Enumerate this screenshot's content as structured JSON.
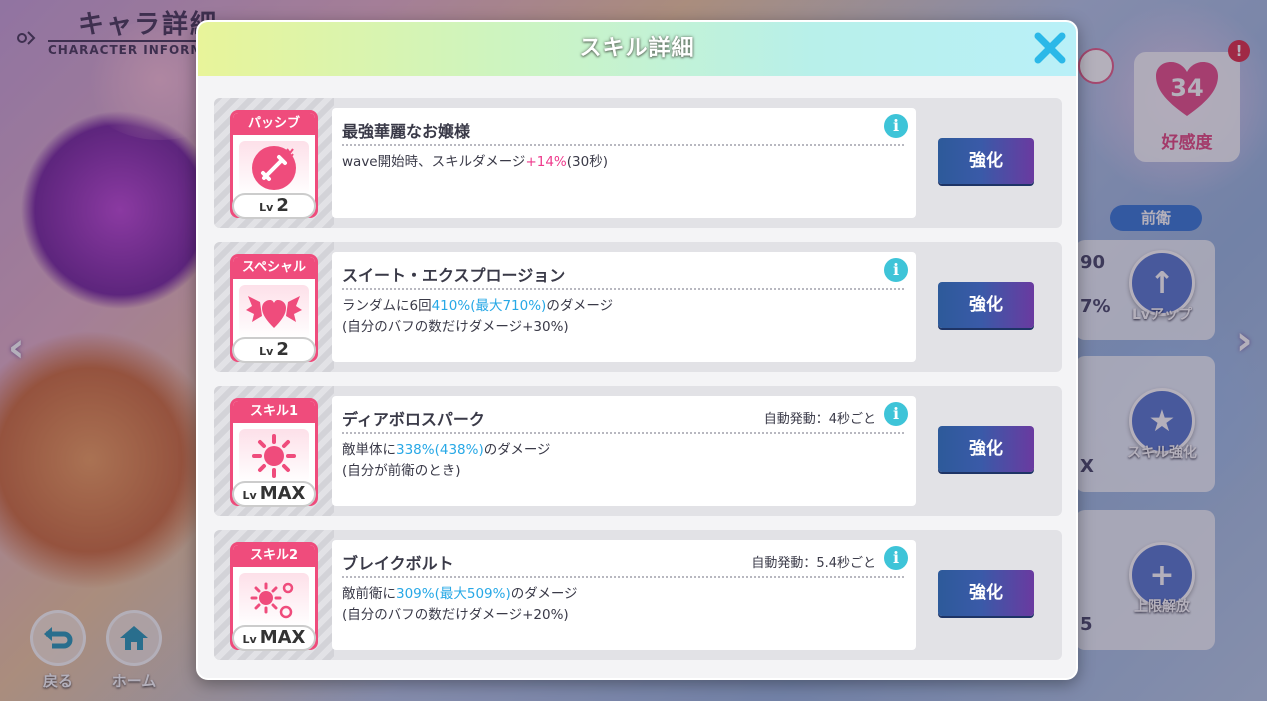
{
  "background": {
    "header_title": "キャラ詳細",
    "header_subtitle": "CHARACTER INFORMATION",
    "back_label": "戻る",
    "home_label": "ホーム",
    "affection_value": "34",
    "affection_label": "好感度",
    "alert_mark": "!",
    "role_badge": "前衛",
    "levelup_label": "Lvアップ",
    "skill_enhance_label": "スキル強化",
    "limit_break_label": "上限解放",
    "peek_values": [
      "90",
      "7%",
      "X",
      "5"
    ]
  },
  "modal": {
    "title": "スキル詳細",
    "enhance_label": "強化",
    "info_glyph": "i",
    "lv_prefix": "Lv",
    "skills": [
      {
        "tag": "パッシブ",
        "level": "2",
        "name": "最強華麗なお嬢様",
        "auto_trigger": "",
        "desc_line1_a": "wave開始時、スキルダメージ",
        "desc_line1_hl": "+14%",
        "desc_line1_b": "(30秒)",
        "desc_line2": "",
        "icon": "sword-icon"
      },
      {
        "tag": "スペシャル",
        "level": "2",
        "name": "スイート・エクスプロージョン",
        "auto_trigger": "",
        "desc_line1_a": "ランダムに6回",
        "desc_line1_hl": "410%(最大710%)",
        "desc_line1_b": "のダメージ",
        "desc_line2": "(自分のバフの数だけダメージ+30%)",
        "icon": "wings-heart-icon"
      },
      {
        "tag": "スキル1",
        "level": "MAX",
        "name": "ディアボロスパーク",
        "auto_trigger": "自動発動：4秒ごと",
        "desc_line1_a": "敵単体に",
        "desc_line1_hl": "338%(438%)",
        "desc_line1_b": "のダメージ",
        "desc_line2": "(自分が前衛のとき)",
        "icon": "sun-burst-icon"
      },
      {
        "tag": "スキル2",
        "level": "MAX",
        "name": "ブレイクボルト",
        "auto_trigger": "自動発動：5.4秒ごと",
        "desc_line1_a": "敵前衛に",
        "desc_line1_hl": "309%(最大509%)",
        "desc_line1_b": "のダメージ",
        "desc_line2": "(自分のバフの数だけダメージ+20%)",
        "icon": "multi-burst-icon"
      }
    ]
  },
  "colors": {
    "accent_pink": "#ef4c7c",
    "highlight_pink": "#ee3a8c",
    "highlight_blue": "#27a8e6",
    "button_gradient_start": "#2d5a9a",
    "button_gradient_end": "#6a3aa0"
  }
}
